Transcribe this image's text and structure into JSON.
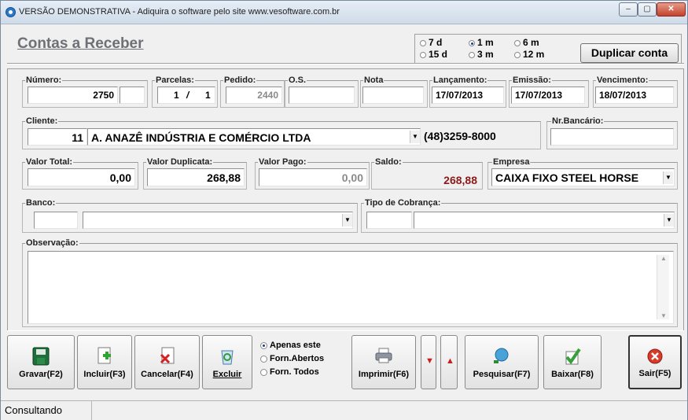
{
  "window": {
    "title": "VERSÃO DEMONSTRATIVA - Adiquira o software pelo site www.vesoftware.com.br"
  },
  "header": {
    "title": "Contas a Receber",
    "periods": [
      {
        "label": "7 d",
        "selected": false
      },
      {
        "label": "1 m",
        "selected": true
      },
      {
        "label": "6 m",
        "selected": false
      },
      {
        "label": "15 d",
        "selected": false
      },
      {
        "label": "3 m",
        "selected": false
      },
      {
        "label": "12 m",
        "selected": false
      }
    ],
    "duplicate_button": "Duplicar conta"
  },
  "form": {
    "numero": {
      "label": "Número:",
      "value": "2750"
    },
    "parcelas": {
      "label": "Parcelas:",
      "value": "1",
      "sep": "/",
      "total": "1"
    },
    "pedido": {
      "label": "Pedido:",
      "value": "2440"
    },
    "os": {
      "label": "O.S.",
      "value": ""
    },
    "nota": {
      "label": "Nota",
      "value": ""
    },
    "lancamento": {
      "label": "Lançamento:",
      "value": "17/07/2013"
    },
    "emissao": {
      "label": "Emissão:",
      "value": "17/07/2013"
    },
    "vencimento": {
      "label": "Vencimento:",
      "value": "18/07/2013"
    },
    "cliente": {
      "label": "Cliente:",
      "code": "11",
      "name": "A. ANAZÊ INDÚSTRIA E COMÉRCIO LTDA",
      "phone": "(48)3259-8000"
    },
    "nr_bancario": {
      "label": "Nr.Bancário:",
      "value": ""
    },
    "valor_total": {
      "label": "Valor Total:",
      "value": "0,00"
    },
    "valor_duplicata": {
      "label": "Valor Duplicata:",
      "value": "268,88"
    },
    "valor_pago": {
      "label": "Valor Pago:",
      "value": "0,00"
    },
    "saldo": {
      "label": "Saldo:",
      "value": "268,88"
    },
    "empresa": {
      "label": "Empresa",
      "value": "CAIXA FIXO STEEL HORSE"
    },
    "banco": {
      "label": "Banco:",
      "code": "",
      "value": ""
    },
    "tipo_cobranca": {
      "label": "Tipo de Cobrança:",
      "code": "",
      "value": ""
    },
    "observacao": {
      "label": "Observação:",
      "value": ""
    }
  },
  "toolbar": {
    "gravar": "Gravar(F2)",
    "incluir": "Incluir(F3)",
    "cancelar": "Cancelar(F4)",
    "excluir": "Excluir",
    "scope_options": [
      {
        "label": "Apenas este",
        "selected": true
      },
      {
        "label": "Forn.Abertos",
        "selected": false
      },
      {
        "label": "Forn. Todos",
        "selected": false
      }
    ],
    "imprimir": "Imprimir(F6)",
    "pesquisar": "Pesquisar(F7)",
    "baixar": "Baixar(F8)",
    "sair": "Sair(F5)"
  },
  "status": {
    "text": "Consultando"
  },
  "colors": {
    "saldo": "#8b1a1a",
    "title": "#6e7076"
  }
}
